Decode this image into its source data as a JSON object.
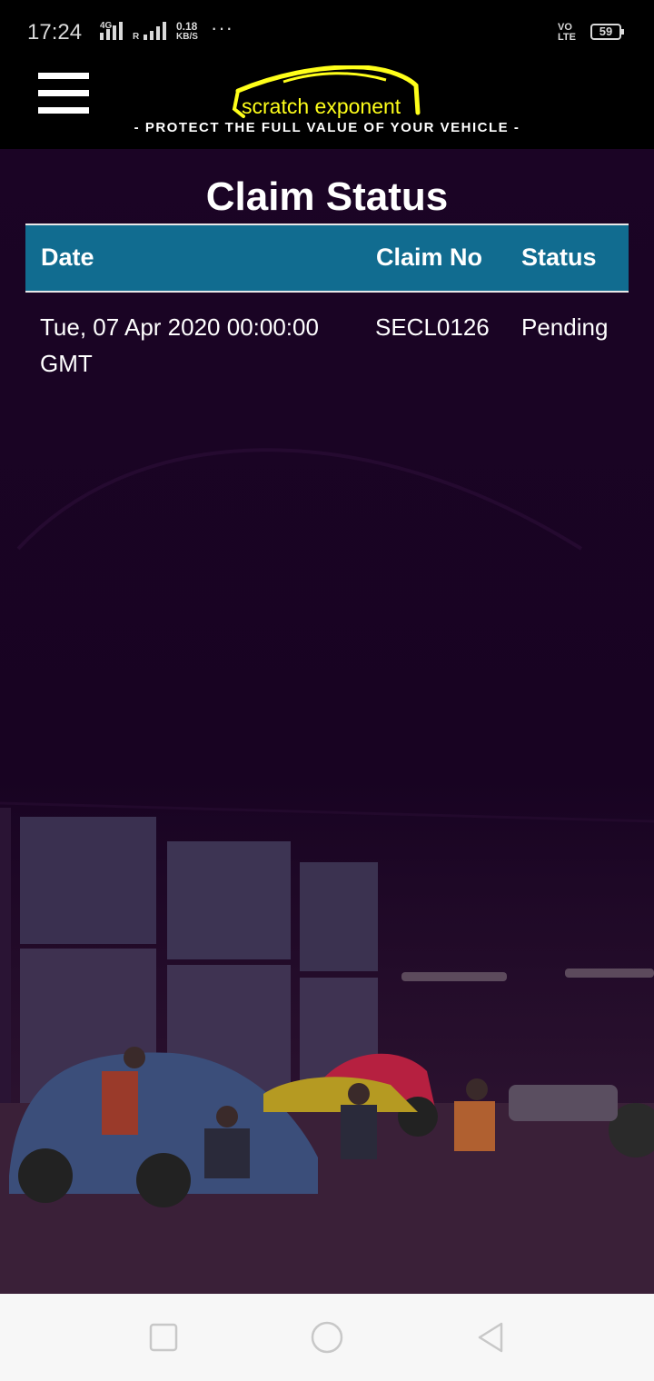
{
  "status_bar": {
    "time": "17:24",
    "network_4g": "4G",
    "roaming": "R",
    "speed_value": "0.18",
    "speed_unit": "KB/S",
    "more": "···",
    "volte_top": "VO",
    "volte_bottom": "LTE",
    "battery": "59"
  },
  "app_bar": {
    "menu_icon": "hamburger-menu-icon",
    "logo_text": "scratch exponent",
    "tagline": "- PROTECT THE FULL VALUE OF YOUR VEHICLE -",
    "logo_color": "#ffff1a"
  },
  "page": {
    "title": "Claim Status"
  },
  "table": {
    "headers": {
      "date": "Date",
      "claim_no": "Claim No",
      "status": "Status"
    },
    "rows": [
      {
        "date_line1": "Tue, 07 Apr 2020 00:00:00",
        "date_line2": "GMT",
        "claim_no": "SECL0126",
        "status": "Pending"
      }
    ],
    "header_color": "#116c90"
  },
  "nav_bar": {
    "recents_icon": "square-recents-icon",
    "home_icon": "circle-home-icon",
    "back_icon": "triangle-back-icon"
  }
}
